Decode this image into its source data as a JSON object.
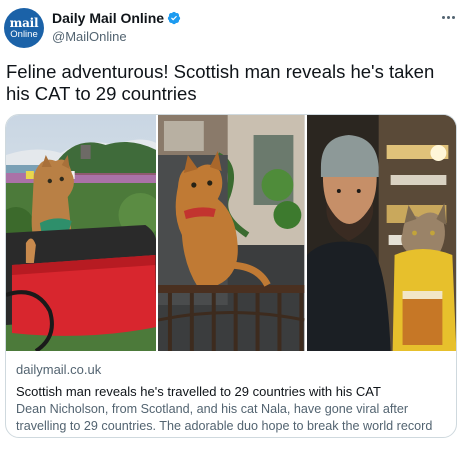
{
  "tweet": {
    "author": {
      "name": "Daily Mail Online",
      "handle": "@MailOnline",
      "avatar_line1": "mail",
      "avatar_line2": "Online",
      "verified": true,
      "verified_color": "#1d9bf0"
    },
    "text": "Feline adventurous! Scottish man reveals he's taken his CAT to 29 countries",
    "more_icon": "more-horizontal-icon",
    "card": {
      "domain": "dailymail.co.uk",
      "title": "Scottish man reveals he's travelled to 29 countries with his CAT",
      "description": "Dean Nicholson, from Scotland, and his cat Nala, have gone viral after travelling to 29 countries. The adorable duo hope to break the world record for number o..."
    }
  }
}
